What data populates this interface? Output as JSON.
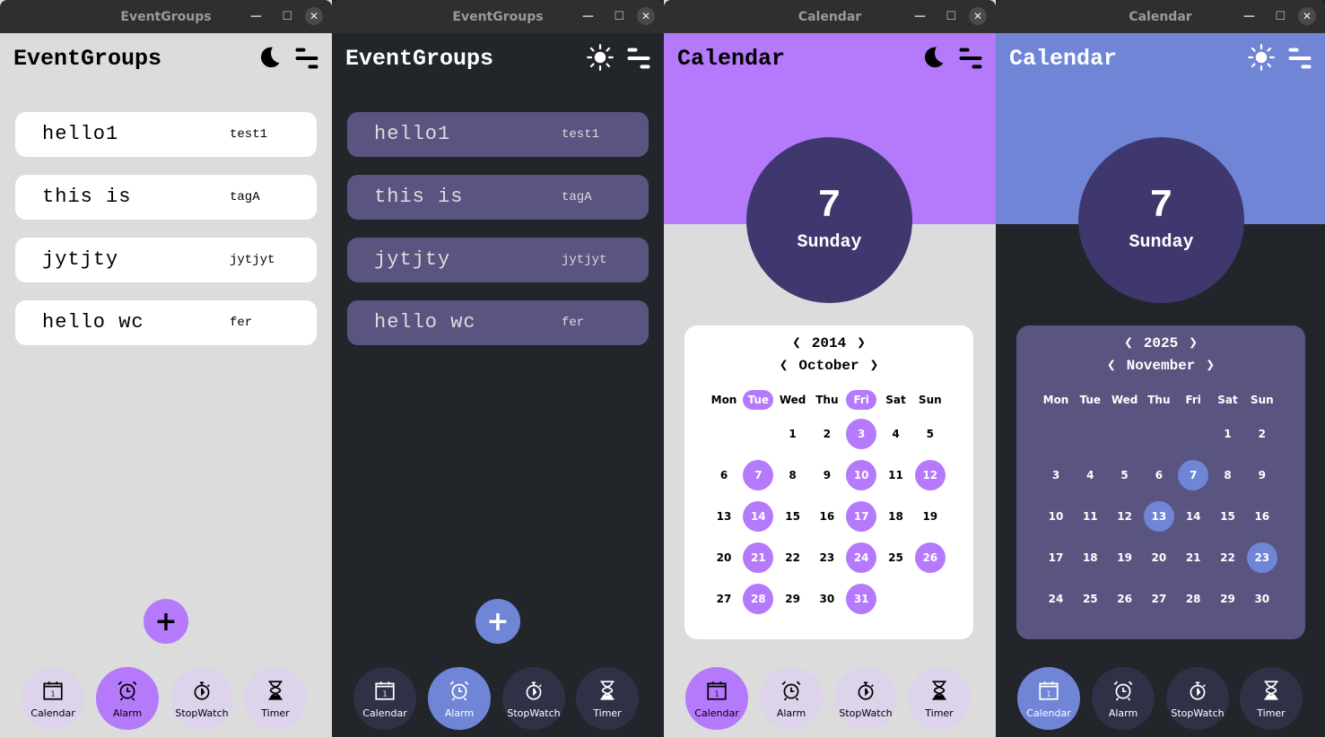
{
  "colors": {
    "light_bg": "#dcdcdc",
    "dark_bg": "#22252a",
    "purple": "#b579fc",
    "blue": "#7185d6",
    "dark_card": "#5a5480",
    "circle": "#3f386e",
    "nav_light": "#ddd3ea",
    "nav_dark": "#303047"
  },
  "nav_labels": [
    "Calendar",
    "Alarm",
    "StopWatch",
    "Timer"
  ],
  "nav_icons": [
    "calendar-icon",
    "alarm-icon",
    "stopwatch-icon",
    "hourglass-icon"
  ],
  "windows": [
    {
      "window_title": "EventGroups",
      "title": "EventGroups",
      "theme": "light",
      "theme_icon": "moon-icon",
      "type": "groups",
      "active_nav": 1,
      "groups": [
        {
          "name": "hello1",
          "tag": "test1"
        },
        {
          "name": "this is",
          "tag": "tagA"
        },
        {
          "name": "jytjty",
          "tag": "jytjyt"
        },
        {
          "name": "hello wc",
          "tag": "fer"
        }
      ],
      "fab": "+"
    },
    {
      "window_title": "EventGroups",
      "title": "EventGroups",
      "theme": "dark",
      "theme_icon": "sun-icon",
      "type": "groups",
      "active_nav": 1,
      "groups": [
        {
          "name": "hello1",
          "tag": "test1"
        },
        {
          "name": "this is",
          "tag": "tagA"
        },
        {
          "name": "jytjty",
          "tag": "jytjyt"
        },
        {
          "name": "hello wc",
          "tag": "fer"
        }
      ],
      "fab": "+"
    },
    {
      "window_title": "Calendar",
      "title": "Calendar",
      "theme": "light",
      "theme_icon": "moon-icon",
      "type": "calendar",
      "active_nav": 0,
      "day": "7",
      "weekday": "Sunday",
      "year": "2014",
      "month": "October",
      "prev": "❮",
      "next": "❯",
      "weekdays": [
        "Mon",
        "Tue",
        "Wed",
        "Thu",
        "Fri",
        "Sat",
        "Sun"
      ],
      "highlight_weekdays": [
        "Tue",
        "Fri"
      ],
      "first_weekday_index": 2,
      "days_in_month": 31,
      "highlight_days": [
        3,
        7,
        10,
        12,
        14,
        17,
        21,
        24,
        26,
        28,
        31
      ]
    },
    {
      "window_title": "Calendar",
      "title": "Calendar",
      "theme": "dark",
      "theme_icon": "sun-icon",
      "type": "calendar",
      "active_nav": 0,
      "day": "7",
      "weekday": "Sunday",
      "year": "2025",
      "month": "November",
      "prev": "❮",
      "next": "❯",
      "weekdays": [
        "Mon",
        "Tue",
        "Wed",
        "Thu",
        "Fri",
        "Sat",
        "Sun"
      ],
      "highlight_weekdays": [],
      "first_weekday_index": 5,
      "days_in_month": 30,
      "highlight_days": [
        7,
        13,
        23
      ]
    }
  ]
}
